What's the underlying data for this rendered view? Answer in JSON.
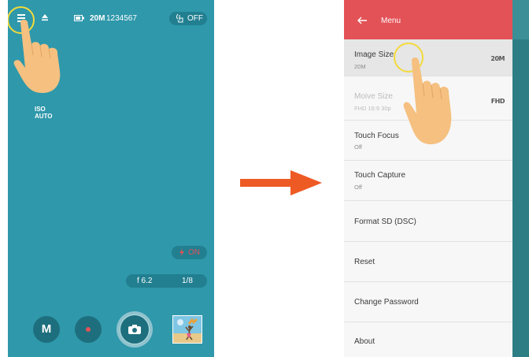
{
  "camera": {
    "topbar": {
      "menu_icon": "hamburger-icon",
      "eject_icon": "eject-icon",
      "battery_icon": "battery-icon",
      "size": "20M",
      "count": "1234567",
      "gesture_label": "OFF"
    },
    "iso": {
      "label": "ISO",
      "value": "AUTO"
    },
    "flash": {
      "label": "ON"
    },
    "exposure": {
      "aperture": "f 6.2",
      "shutter": "1/8"
    },
    "mode_label": "M"
  },
  "menu": {
    "title": "Menu",
    "items": [
      {
        "label": "Image Size",
        "sub": "20M",
        "value": "20M"
      },
      {
        "label": "Moive Size",
        "sub": "FHD 16:9 30p",
        "value": "FHD"
      },
      {
        "label": "Touch Focus",
        "sub": "Off"
      },
      {
        "label": "Touch Capture",
        "sub": "Off"
      },
      {
        "label": "Format SD (DSC)"
      },
      {
        "label": "Reset"
      },
      {
        "label": "Change Password"
      },
      {
        "label": "About"
      }
    ]
  },
  "colors": {
    "camera_bg": "#2f98ab",
    "menu_header": "#e35257",
    "arrow": "#ee5a24",
    "highlight_ring": "#f3da3a",
    "hand": "#f5c080"
  }
}
